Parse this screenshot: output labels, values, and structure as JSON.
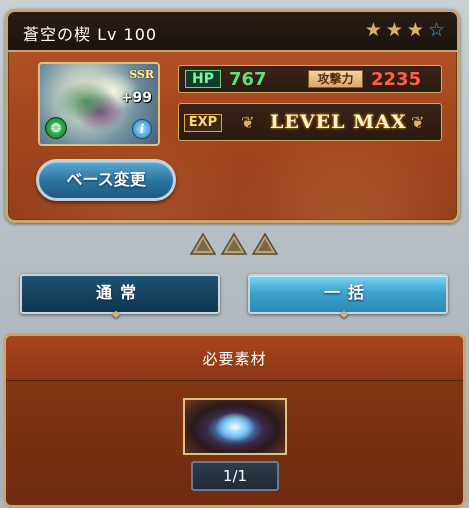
{
  "weapon": {
    "name": "蒼空の楔 Lv 100",
    "rarity": "SSR",
    "plus": "+99",
    "element": "wind",
    "stars_total": 4,
    "stars_filled": 3,
    "stars": [
      {
        "state": "filled",
        "icon": "star-icon",
        "color": "#d9b06c"
      },
      {
        "state": "filled",
        "icon": "star-icon",
        "color": "#d9b06c"
      },
      {
        "state": "filled",
        "icon": "star-icon",
        "color": "#d9b06c"
      },
      {
        "state": "empty",
        "icon": "star-icon",
        "color": "#3aa6d8"
      }
    ]
  },
  "stats": {
    "hp_label": "HP",
    "hp_value": "767",
    "atk_label": "攻撃力",
    "atk_value": "2235"
  },
  "exp": {
    "label": "EXP",
    "status": "LEVEL MAX"
  },
  "buttons": {
    "base_change": "ベース変更",
    "mode_normal": "通常",
    "mode_bulk": "一括"
  },
  "materials": {
    "title": "必要素材",
    "count": "1/1"
  },
  "colors": {
    "card_bg": "#a6471d",
    "frame_gold": "#c9a66b",
    "hp_green": "#5fe07c",
    "atk_red": "#ff5e46",
    "button_blue": "#2d76a3"
  }
}
